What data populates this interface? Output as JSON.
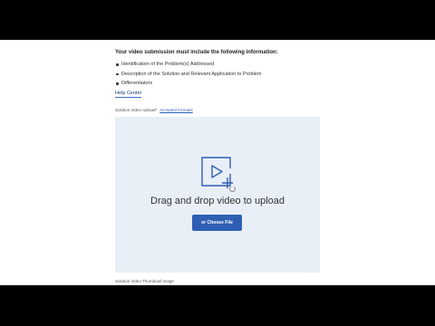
{
  "instructions": {
    "intro": "Your video submission must include the following information:",
    "items": [
      {
        "text": "Identification of the Problem(s) Addressed"
      },
      {
        "text": "Description of the Solution and Relevant Application to Problem"
      },
      {
        "text": "Differentiators"
      }
    ]
  },
  "help_center": {
    "label": "Help Center"
  },
  "upload": {
    "label": "Solution Video Upload*",
    "formats_link": "Accepted Formats",
    "drop_text": "Drag and drop video to upload",
    "choose_button": "or Choose File",
    "icon": "video-upload-icon",
    "accent_color": "#2f5fb3",
    "dropzone_color": "#e9eff7"
  },
  "thumbnail": {
    "label": "Solution Video Thumbnail Image"
  }
}
